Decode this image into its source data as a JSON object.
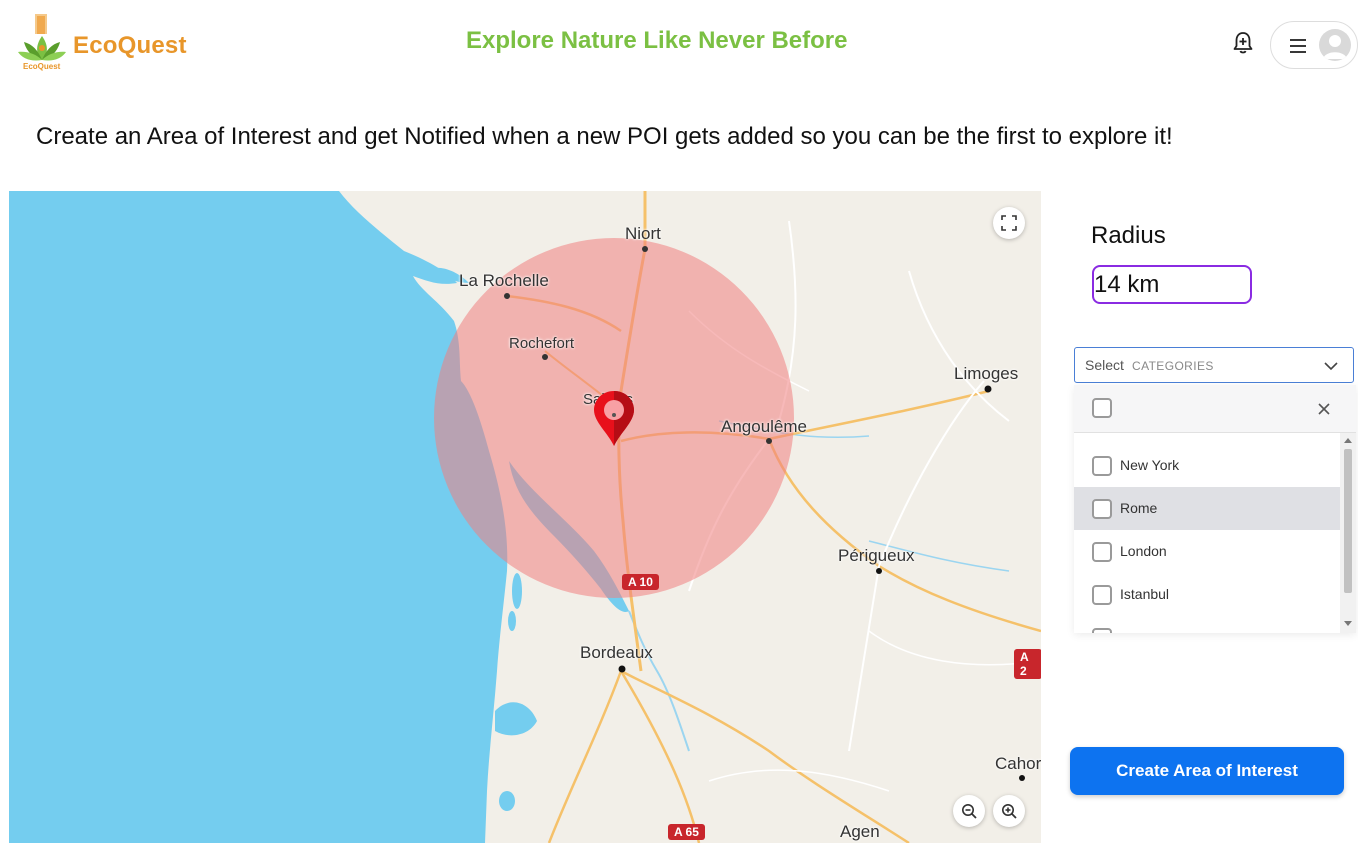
{
  "header": {
    "logo_text": "EcoQuest",
    "logo_subtext": "EcoQuest",
    "tagline": "Explore Nature Like Never Before",
    "notification_icon": "bell-plus-icon",
    "menu_icon": "hamburger-icon",
    "avatar_icon": "user-avatar-icon"
  },
  "intro_text": "Create an Area of Interest and get Notified when a new POI gets added so you can be the first to explore it!",
  "map": {
    "cities": {
      "niort": "Niort",
      "la_rochelle": "La Rochelle",
      "rochefort": "Rochefort",
      "saintes": "Saintes",
      "angouleme": "Angoulême",
      "limoges": "Limoges",
      "perigueux": "Périgueux",
      "bordeaux": "Bordeaux",
      "cahors": "Cahor",
      "agen": "Agen"
    },
    "roads": {
      "a10": "A 10",
      "a65": "A 65",
      "a2": "A 2"
    },
    "radius_circle_color": "#f08080",
    "marker_color": "#e8101b",
    "controls": {
      "fullscreen_icon": "fullscreen-icon",
      "zoom_out_icon": "zoom-out-icon",
      "zoom_in_icon": "zoom-in-icon"
    }
  },
  "radius": {
    "label": "Radius",
    "value": "14 km"
  },
  "category_select": {
    "label": "Select",
    "placeholder": "CATEGORIES",
    "options": [
      "New York",
      "Rome",
      "London",
      "Istanbul"
    ],
    "highlighted": "Rome"
  },
  "create_button": "Create Area of Interest",
  "colors": {
    "brand_orange": "#e8962a",
    "brand_green": "#7bc043",
    "primary_blue": "#0d73f0",
    "input_border": "#8a2be2",
    "water": "#74cdef"
  }
}
